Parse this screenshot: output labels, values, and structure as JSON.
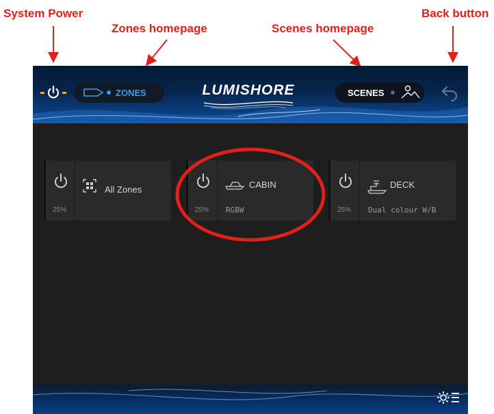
{
  "callouts": {
    "system_power": "System Power",
    "zones_homepage": "Zones homepage",
    "scenes_homepage": "Scenes homepage",
    "back_button": "Back button"
  },
  "header": {
    "zones_label": "ZONES",
    "logo": "LUMISHORE",
    "scenes_label": "SCENES"
  },
  "zones": [
    {
      "name": "All Zones",
      "percent": "25%",
      "type": "",
      "icon": "grid-icon"
    },
    {
      "name": "CABIN",
      "percent": "25%",
      "type": "RGBW",
      "icon": "cabin-boat-icon"
    },
    {
      "name": "DECK",
      "percent": "25%",
      "type": "Dual colour W/B",
      "icon": "deck-boat-icon"
    }
  ],
  "colors": {
    "annotation": "#e0201b",
    "power_accent": "#f5b21a",
    "zones_accent": "#3d9be9"
  }
}
